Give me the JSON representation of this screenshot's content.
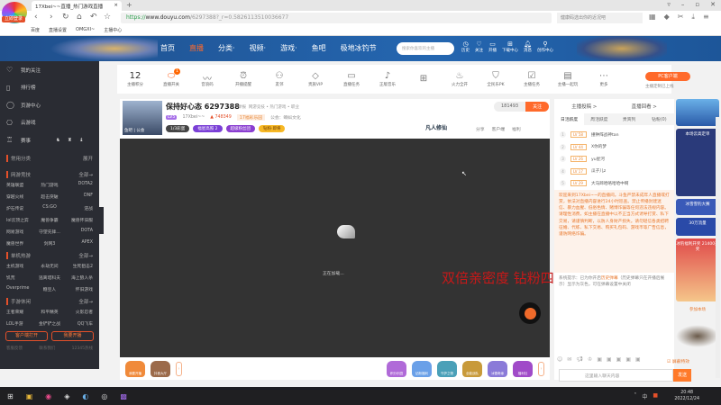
{
  "browser": {
    "logo_badge": "立即登录",
    "tab_title": "17Xbei~~直播_热门游戏直播",
    "url_scheme": "https://",
    "url_domain": "www.douyu.com",
    "url_path": "/6297388?_r=0.5826113510036677",
    "search_placeholder": "健康码选出你的近况吧",
    "bookmarks": [
      "百度",
      "直播设置",
      "OMGXI~",
      "主播中心"
    ]
  },
  "header": {
    "nav": [
      "首页",
      "直播",
      "分类·",
      "视频·",
      "游戏·",
      "鱼吧",
      "极地冰钓节"
    ],
    "search_placeholder": "搜索你喜欢的主播",
    "icons": [
      {
        "icon": "history-icon",
        "label": "历史"
      },
      {
        "icon": "heart-icon",
        "label": "关注"
      },
      {
        "icon": "broadcast-icon",
        "label": "开播"
      },
      {
        "icon": "download-icon",
        "label": "下载中心"
      },
      {
        "icon": "bell-icon",
        "label": "消息",
        "badge": "3"
      },
      {
        "icon": "location-icon",
        "label": "创作中心"
      }
    ]
  },
  "sidebar": {
    "items": [
      {
        "icon": "heart-icon",
        "label": "我的关注"
      },
      {
        "icon": "ranking-icon",
        "label": "排行榜"
      },
      {
        "icon": "mobile-game-icon",
        "label": "页游中心"
      },
      {
        "icon": "gamepad-icon",
        "label": "云游戏"
      },
      {
        "icon": "trophy-icon",
        "label": "赛事"
      }
    ],
    "sections": [
      {
        "title": "常用分类",
        "more": "展开",
        "items": []
      },
      {
        "title": "网游竞技",
        "more": "全部→",
        "items": [
          "英雄联盟",
          "热门游戏",
          "DOTA2",
          "穿越火线",
          "超击突破",
          "DNF",
          "炉石传说",
          "CS:GO",
          "逆战",
          "lol云顶之弈",
          "魔兽争霸",
          "魔兽怀旧服",
          "网易游戏",
          "守望先锋...",
          "DOTA",
          "魔兽世界",
          "剑网3",
          "APEX"
        ]
      },
      {
        "title": "单机热游",
        "more": "全部→",
        "items": [
          "主机游戏",
          "永劫无间",
          "生死狙击2",
          "饥荒",
          "逃离塔科夫",
          "海上狼人杀",
          "Overprime",
          "糖豆人",
          "怀旧游戏"
        ]
      },
      {
        "title": "手游休闲",
        "more": "全部→",
        "items": [
          "王者荣耀",
          "和平精英",
          "火影忍者",
          "LOL手游",
          "金铲铲之战",
          "QQ飞车"
        ]
      }
    ],
    "buttons": [
      "客户端打开",
      "我要开播"
    ],
    "footer": [
      "客服反馈",
      "联系我们",
      "12345热线"
    ]
  },
  "toolbar": {
    "points_value": "12",
    "points_label": "主播积分",
    "items": [
      {
        "icon": "toggle-icon",
        "label": "直播开关",
        "badge": "1"
      },
      {
        "icon": "waveform-icon",
        "label": "音浪码"
      },
      {
        "icon": "alarm-icon",
        "label": "开播提醒"
      },
      {
        "icon": "friends-icon",
        "label": "友邻"
      },
      {
        "icon": "diamond-icon",
        "label": "贵族VIP"
      },
      {
        "icon": "ad-icon",
        "label": "直播任务"
      },
      {
        "icon": "music-icon",
        "label": "正版音乐"
      },
      {
        "icon": "gift-icon",
        "label": ""
      },
      {
        "icon": "fire-icon",
        "label": "火力全开"
      },
      {
        "icon": "pk-icon",
        "label": "全民乐PK"
      },
      {
        "icon": "task-icon",
        "label": "主播任务"
      },
      {
        "icon": "clipboard-icon",
        "label": "主播一起玩"
      },
      {
        "icon": "more-icon",
        "label": "更多"
      }
    ],
    "pc_button": "PC客户端",
    "pc_sub": "主播定制已上线"
  },
  "streamer": {
    "avatar_tags": "鱼吧 | 公会",
    "name": "保持好心态",
    "room_id": "6297388",
    "report": "举报",
    "category": "网游竞技 • 热门游戏 • 职业",
    "level": "LV5",
    "owner": "17Xbei~~",
    "hot": "748349",
    "verified": "17福彩乐园",
    "guild": "公会：蝌蚪文化",
    "badges": [
      "1/3彩蛋",
      "福星高照 2",
      "超级粉丝团",
      "钻粉·即将"
    ],
    "follow_count": "181493",
    "follow_label": "关注",
    "game_logo": "凡人修仙",
    "share": "分享",
    "client": "客户端",
    "welfare": "福利"
  },
  "video": {
    "loading": "正在加载...",
    "overlay_text": "双倍亲密度 钻粉四倍"
  },
  "gift_bar": {
    "left": [
      "我要开播",
      "抖音大厅"
    ],
    "left_badge": "1",
    "right": [
      "积分乐园",
      "钻粉福利",
      "守护之物",
      "全能战队",
      "冰雪奇缘",
      "福利社"
    ]
  },
  "right_panel": {
    "links": [
      "主播投稿 >",
      "直播回看 >"
    ],
    "tabs": [
      "日活跃度",
      "周活跃度",
      "贵宾列",
      "钻粉(0)"
    ],
    "ranks": [
      {
        "n": "1",
        "lv": "LV 58",
        "name": "撞钟阵战神tan"
      },
      {
        "n": "2",
        "lv": "LV 44",
        "name": "X你的梦"
      },
      {
        "n": "3",
        "lv": "LV 26",
        "name": "yu星河"
      },
      {
        "n": "4",
        "lv": "LV 17",
        "name": "瓜子儿z"
      },
      {
        "n": "5",
        "lv": "LV 29",
        "name": "大马蹄哈咯哈哈中啊"
      }
    ],
    "notice": "欢迎来到17Xbei~~的直播间。斗鱼严禁未成年人直播或打赏，依法对直播内容进行24小时巡查。禁止传播封建迷信、暴力血腥、低俗色情、赌博诈骗等任何违法违规内容。请理性消费，如主播在直播中以不正当方式诱导打赏、私下交易，请谨慎判断，以防人身财产损失。请勿轻信各类招聘征婚、代练、私下交易、购买礼包码、游戏币等广告信息，谨防网络诈骗。",
    "notice2_a": "系统提示：已为你开启",
    "notice2_link": "历史弹幕",
    "notice2_b": "（历史弹幕只在开播后展示）显示为灰色，可在弹幕设置中关闭",
    "shield": "屏蔽特效",
    "chat_placeholder": "这里输入聊天内容",
    "send": "发送"
  },
  "ads": [
    "本场云高定单",
    "30万流量",
    "冰雪雪钓大赛",
    "冰钓福利开奖 21400开奖",
    "参加本场"
  ],
  "taskbar": {
    "time": "20:48",
    "date": "2022/12/24",
    "ime": "中"
  }
}
